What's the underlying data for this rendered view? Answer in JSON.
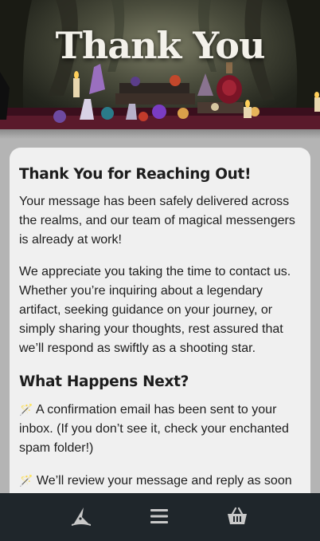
{
  "hero": {
    "title": "Thank You"
  },
  "card": {
    "heading": "Thank You for Reaching Out!",
    "para1": "Your message has been safely delivered across the realms, and our team of magical messengers is already at work!",
    "para2": "We appreciate you taking the time to contact us. Whether you’re inquiring about a legendary artifact, seeking guidance on your journey, or simply sharing your thoughts, rest assured that we’ll respond as swiftly as a shooting star.",
    "heading2": "What Happens Next?",
    "steps": [
      {
        "icon": "🪄",
        "text": " A confirmation email has been sent to your inbox. (If you don’t see it, check your enchanted spam folder!)"
      },
      {
        "icon": "🪄",
        "text": " We’ll review your message and reply as soon as possible."
      }
    ]
  },
  "bottom_nav": {
    "items": [
      {
        "icon": "wizard-hat-icon"
      },
      {
        "icon": "menu-icon"
      },
      {
        "icon": "basket-icon"
      }
    ]
  },
  "colors": {
    "page_bg": "#b4b4b4",
    "card_bg": "#f0f0f0",
    "nav_bg": "#1f262b",
    "nav_icon": "#c9c9c9"
  }
}
